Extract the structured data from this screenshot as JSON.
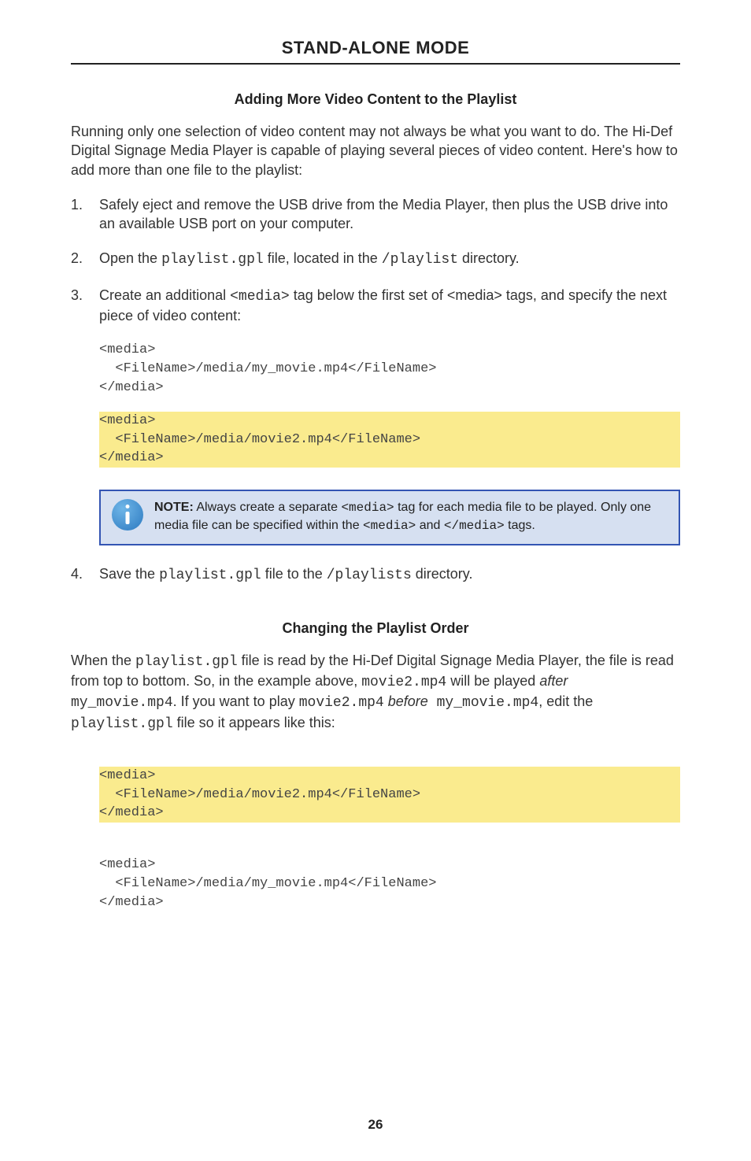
{
  "header": "STAND-ALONE MODE",
  "section1": {
    "title": "Adding More Video Content to the Playlist",
    "intro": "Running only one selection of video content may not always be what you want to do.  The Hi-Def Digital Signage Media Player is capable of playing several pieces of video content. Here's how to add more than one file to the playlist:",
    "step1_num": "1.",
    "step1_a": "Safely eject and remove the USB drive from the Media Player, then plus the USB drive into an available USB port on your computer.",
    "step2_num": "2.",
    "step2_pre": "Open the  ",
    "step2_code1": "playlist.gpl",
    "step2_mid": " file, located in the ",
    "step2_code2": "/playlist",
    "step2_post": " directory.",
    "step3_num": "3.",
    "step3_pre": "Create an additional ",
    "step3_code": "<media>",
    "step3_post": " tag below the first set of <media> tags, and specify the next piece of video content:",
    "code1_l1": "<media>",
    "code1_l2": "  <FileName>/media/my_movie.mp4</FileName>",
    "code1_l3": "</media>",
    "code1_h1": "<media>",
    "code1_h2": "  <FileName>/media/movie2.mp4</FileName>",
    "code1_h3": "</media>",
    "note_bold": "NOTE:",
    "note_a": " Always create a separate ",
    "note_c1": "<media>",
    "note_b": " tag for each media file to be played.  Only one media file can be specified within the ",
    "note_c2": "<media>",
    "note_c": " and ",
    "note_c3": "</media>",
    "note_d": " tags.",
    "step4_num": "4.",
    "step4_pre": "Save the ",
    "step4_code1": "playlist.gpl",
    "step4_mid": " file to the ",
    "step4_code2": "/playlists",
    "step4_post": " directory."
  },
  "section2": {
    "title": "Changing the Playlist Order",
    "p_a": "When the ",
    "p_c1": "playlist.gpl",
    "p_b": " file is read by the Hi-Def Digital Signage Media Player, the file is read from top to bottom.  So, in the example above, ",
    "p_c2": "movie2.mp4",
    "p_c": " will be played ",
    "p_i1": "after",
    "p_c3": " my_movie.mp4",
    "p_d": ".  If you want to play ",
    "p_c4": "movie2.mp4",
    "p_e": " ",
    "p_i2": "before",
    "p_c5": " my_movie.mp4",
    "p_f": ", edit the ",
    "p_c6": "playlist.gpl",
    "p_g": " file so it appears like this:",
    "code2_h1": "<media>",
    "code2_h2": "  <FileName>/media/movie2.mp4</FileName>",
    "code2_h3": "</media>",
    "code2_l1": "<media>",
    "code2_l2": "  <FileName>/media/my_movie.mp4</FileName>",
    "code2_l3": "</media>"
  },
  "pagenum": "26"
}
